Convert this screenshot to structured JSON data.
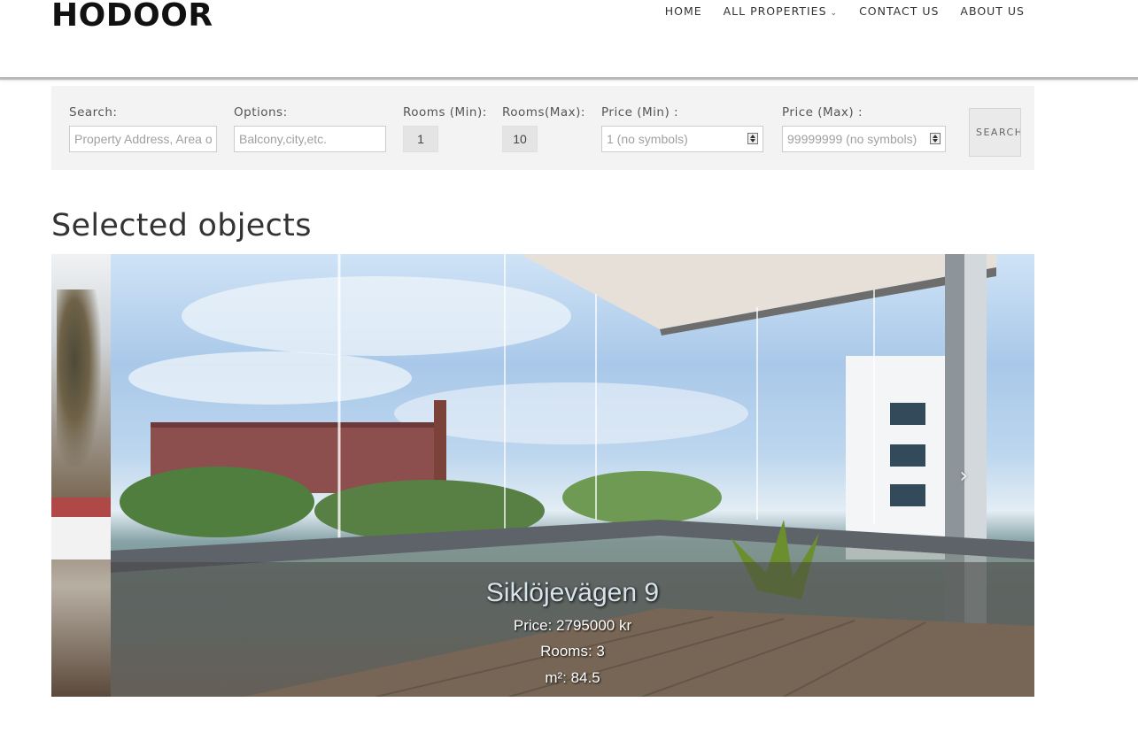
{
  "brand": {
    "logo_text": "HODOOR"
  },
  "nav": {
    "items": [
      {
        "label": "HOME",
        "has_dropdown": false
      },
      {
        "label": "ALL PROPERTIES",
        "has_dropdown": true
      },
      {
        "label": "CONTACT US",
        "has_dropdown": false
      },
      {
        "label": "ABOUT US",
        "has_dropdown": false
      }
    ],
    "dropdown_icon": "chevron-down-icon"
  },
  "search": {
    "search_label": "Search:",
    "search_placeholder": "Property Address, Area or",
    "options_label": "Options:",
    "options_placeholder": "Balcony,city,etc.",
    "rooms_min_label": "Rooms (Min):",
    "rooms_min_value": "1",
    "rooms_max_label": "Rooms(Max):",
    "rooms_max_value": "10",
    "price_min_label": "Price (Min) :",
    "price_min_placeholder": "1 (no symbols)",
    "price_max_label": "Price (Max) :",
    "price_max_placeholder": "99999999 (no symbols)",
    "button_label": "SEARCH"
  },
  "section": {
    "title": "Selected objects"
  },
  "slider": {
    "next_icon": "chevron-right-icon",
    "current": {
      "title": "Siklöjevägen 9",
      "price_line": "Price: 2795000 kr",
      "rooms_line": "Rooms: 3",
      "area_line": "m²: 84.5"
    }
  },
  "colors": {
    "panel_bg": "#f3f3f3",
    "header_border": "#b9b9b9",
    "caption_overlay": "rgba(70,70,70,0.55)"
  }
}
